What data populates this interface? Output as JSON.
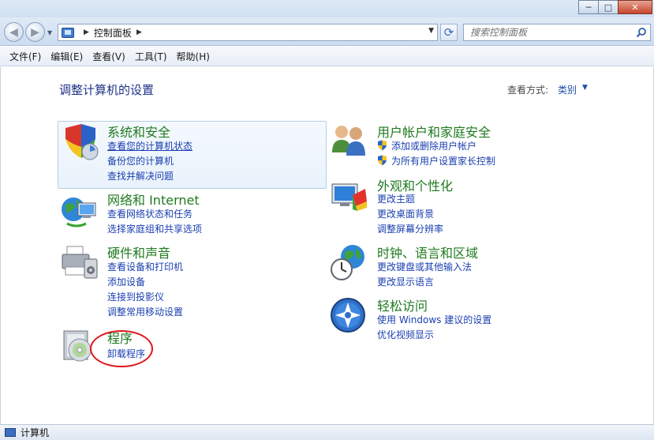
{
  "window": {
    "controls": [
      "─",
      "□",
      "✕"
    ]
  },
  "navigation": {
    "back": "◀",
    "forward": "▶",
    "address_crumbs": [
      "控制面板"
    ],
    "search_placeholder": "搜索控制面板"
  },
  "menubar": {
    "items": [
      "文件(F)",
      "编辑(E)",
      "查看(V)",
      "工具(T)",
      "帮助(H)"
    ]
  },
  "main": {
    "title": "调整计算机的设置",
    "view_by_label": "查看方式:",
    "view_by_value": "类别",
    "categories": [
      {
        "title": "系统和安全",
        "links": [
          "查看您的计算机状态",
          "备份您的计算机",
          "查找并解决问题"
        ]
      },
      {
        "title": "网络和 Internet",
        "links": [
          "查看网络状态和任务",
          "选择家庭组和共享选项"
        ]
      },
      {
        "title": "硬件和声音",
        "links": [
          "查看设备和打印机",
          "添加设备",
          "连接到投影仪",
          "调整常用移动设置"
        ]
      },
      {
        "title": "程序",
        "links": [
          "卸载程序"
        ]
      },
      {
        "title": "用户帐户和家庭安全",
        "links": [
          "添加或删除用户帐户",
          "为所有用户设置家长控制"
        ]
      },
      {
        "title": "外观和个性化",
        "links": [
          "更改主题",
          "更改桌面背景",
          "调整屏幕分辨率"
        ]
      },
      {
        "title": "时钟、语言和区域",
        "links": [
          "更改键盘或其他输入法",
          "更改显示语言"
        ]
      },
      {
        "title": "轻松访问",
        "links": [
          "使用 Windows 建议的设置",
          "优化视频显示"
        ]
      }
    ]
  },
  "statusbar": {
    "text": "计算机"
  },
  "colors": {
    "category_title": "#1f7a1f",
    "link": "#1a3fb0",
    "page_title": "#1e3287",
    "annotation_circle": "#e0141b"
  }
}
